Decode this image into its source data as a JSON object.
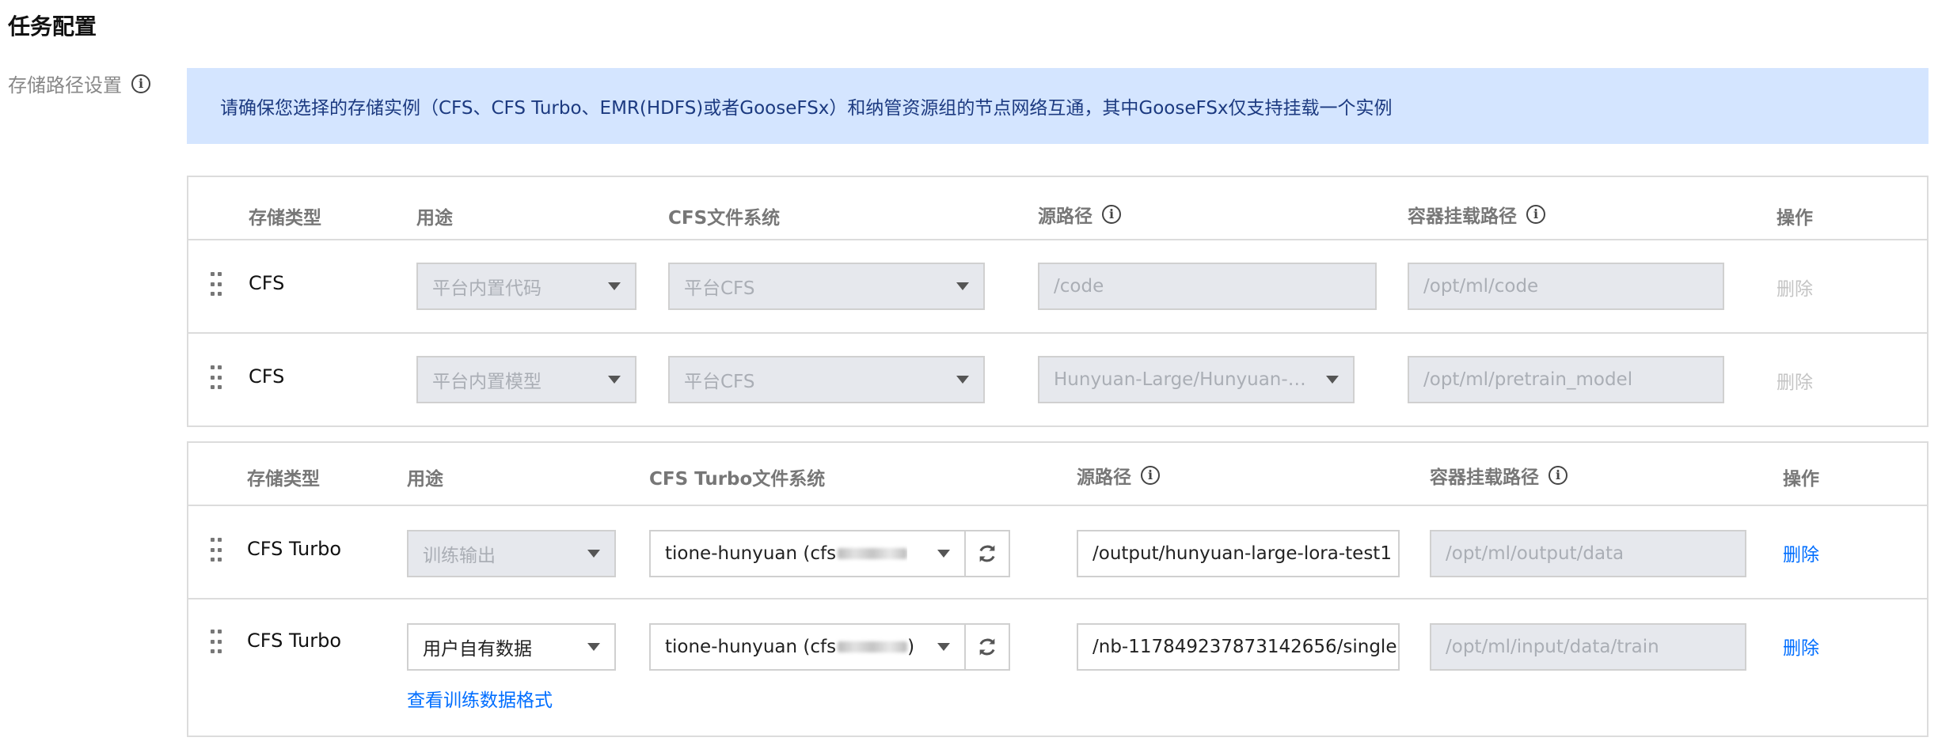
{
  "section_title": "任务配置",
  "storage_label": "存储路径设置",
  "alert_text": "请确保您选择的存储实例（CFS、CFS Turbo、EMR(HDFS)或者GooseFSx）和纳管资源组的节点网络互通，其中GooseFSx仅支持挂载一个实例",
  "table1": {
    "headers": {
      "storage_type": "存储类型",
      "usage": "用途",
      "fs": "CFS文件系统",
      "source_path": "源路径",
      "mount_path": "容器挂载路径",
      "actions": "操作"
    },
    "rows": [
      {
        "type": "CFS",
        "usage": "平台内置代码",
        "fs": "平台CFS",
        "source": "/code",
        "mount": "/opt/ml/code",
        "delete": "删除"
      },
      {
        "type": "CFS",
        "usage": "平台内置模型",
        "fs": "平台CFS",
        "source": "Hunyuan-Large/Hunyuan-L...",
        "mount": "/opt/ml/pretrain_model",
        "delete": "删除"
      }
    ]
  },
  "table2": {
    "headers": {
      "storage_type": "存储类型",
      "usage": "用途",
      "fs": "CFS Turbo文件系统",
      "source_path": "源路径",
      "mount_path": "容器挂载路径",
      "actions": "操作"
    },
    "rows": [
      {
        "type": "CFS Turbo",
        "usage": "训练输出",
        "fs_prefix": "tione-hunyuan (cfs",
        "fs_suffix": "",
        "source": "/output/hunyuan-large-lora-test1",
        "mount": "/opt/ml/output/data",
        "delete": "删除"
      },
      {
        "type": "CFS Turbo",
        "usage": "用户自有数据",
        "fs_prefix": "tione-hunyuan (cfs",
        "fs_suffix": ")",
        "source": "/nb-1178492378731426​56/single",
        "mount": "/opt/ml/input/data/train",
        "delete": "删除",
        "link": "查看训练数据格式"
      }
    ]
  },
  "icons": {
    "info": "info-circle-icon",
    "drag": "drag-handle-icon",
    "caret": "caret-down-icon",
    "refresh": "refresh-icon"
  },
  "colors": {
    "alert_bg": "#d4e5ff",
    "alert_text": "#1c3a80",
    "link": "#006eff",
    "disabled_field": "#e6e8ed"
  }
}
